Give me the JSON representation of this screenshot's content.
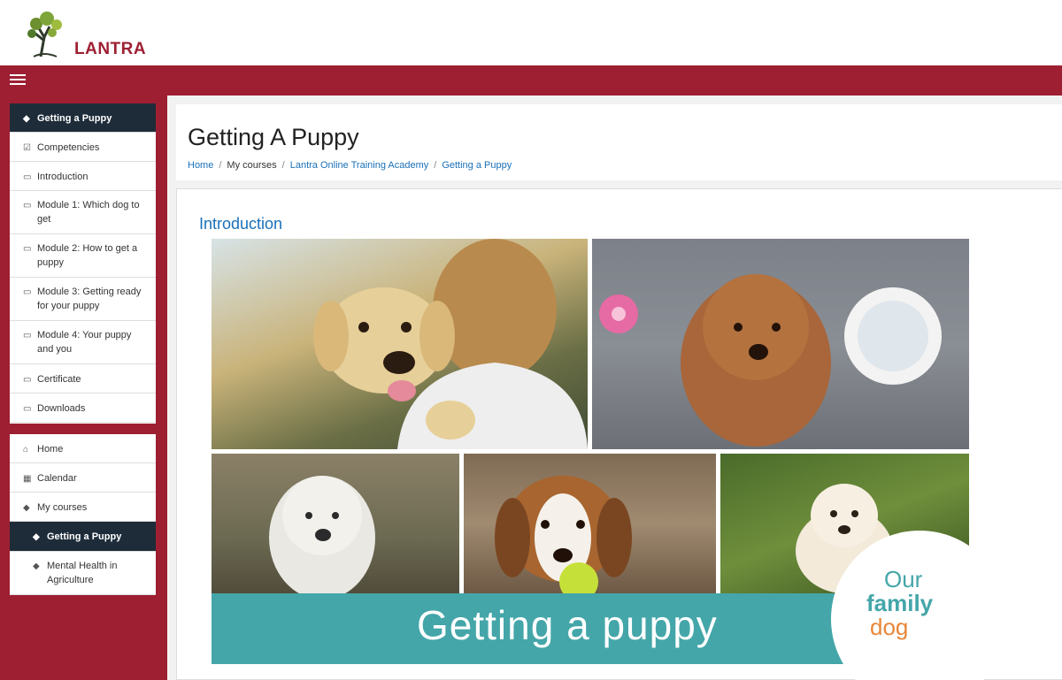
{
  "brand": {
    "logo_text": "LANTRA",
    "colors": {
      "primary": "#9e1f32",
      "nav_active": "#1e2c3a",
      "link": "#1a70b8",
      "teal": "#44a6a9",
      "orange": "#e8873a"
    }
  },
  "navbar": {
    "menu_icon": "hamburger-icon"
  },
  "sidebar": {
    "course_block": [
      {
        "label": "Getting a Puppy",
        "icon": "graduation-cap-icon",
        "active": true
      },
      {
        "label": "Competencies",
        "icon": "checkbox-icon"
      },
      {
        "label": "Introduction",
        "icon": "folder-icon"
      },
      {
        "label": "Module 1: Which dog to get",
        "icon": "folder-icon"
      },
      {
        "label": "Module 2: How to get a puppy",
        "icon": "folder-icon"
      },
      {
        "label": "Module 3: Getting ready for your puppy",
        "icon": "folder-icon"
      },
      {
        "label": "Module 4: Your puppy and you",
        "icon": "folder-icon"
      },
      {
        "label": "Certificate",
        "icon": "folder-icon"
      },
      {
        "label": "Downloads",
        "icon": "folder-icon"
      }
    ],
    "nav_block": [
      {
        "label": "Home",
        "icon": "home-icon"
      },
      {
        "label": "Calendar",
        "icon": "calendar-icon"
      },
      {
        "label": "My courses",
        "icon": "graduation-cap-icon"
      },
      {
        "label": "Getting a Puppy",
        "icon": "graduation-cap-icon",
        "active": true
      },
      {
        "label": "Mental Health in Agriculture",
        "icon": "graduation-cap-icon"
      }
    ]
  },
  "page": {
    "title": "Getting A Puppy",
    "breadcrumb": [
      "Home",
      "My courses",
      "Lantra Online Training Academy",
      "Getting a Puppy"
    ],
    "section_title": "Introduction"
  },
  "banner": {
    "headline": "Getting a puppy",
    "badge_line1": "Our",
    "badge_line2": "family",
    "badge_line3": "dog"
  }
}
